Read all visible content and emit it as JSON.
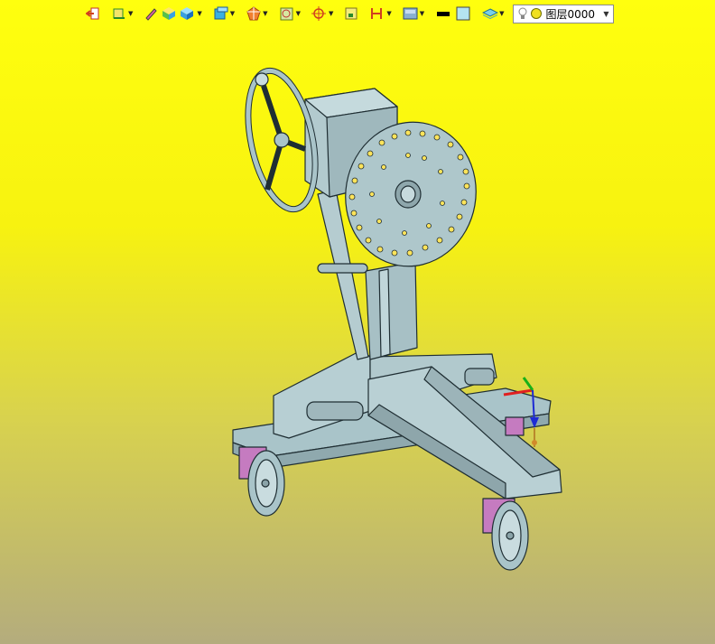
{
  "toolbar": {
    "layer_select_value": "图层0000",
    "buttons": [
      "exit-sketch",
      "wire-frame",
      "pencil",
      "solid-shade",
      "box-view",
      "view-cube",
      "section-view",
      "reference-view",
      "snap",
      "fit",
      "dimension",
      "render-style",
      "line-color",
      "fill-color",
      "layer-tool",
      "light-bulb",
      "layer-status"
    ]
  },
  "colors": {
    "background_top": "#ffff0e",
    "background_bottom": "#b4ac7d",
    "model_fill": "#a9c4c9",
    "model_edge": "#1f2e33",
    "caster": "#c57bc0",
    "axis_x": "#e02020",
    "axis_y": "#18b018",
    "axis_z": "#1d2bd4"
  }
}
